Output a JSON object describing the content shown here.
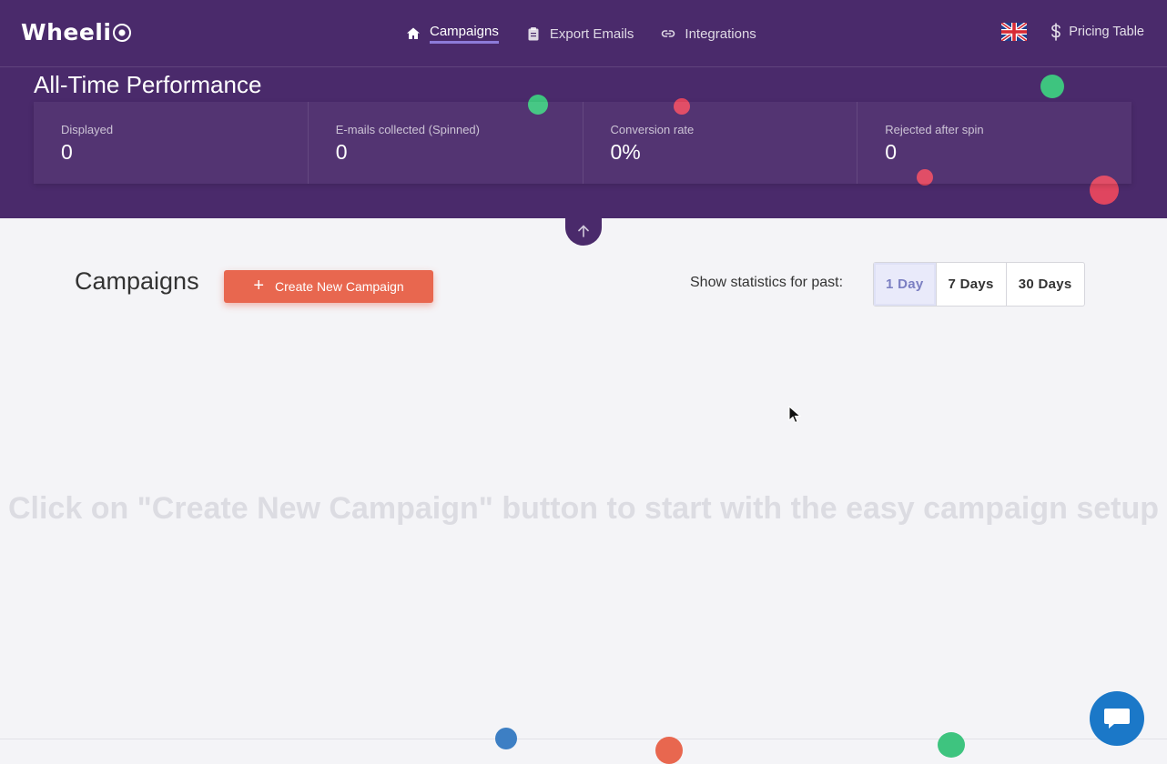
{
  "logo": {
    "text": "Wheeli"
  },
  "nav": {
    "items": [
      {
        "label": "Campaigns",
        "icon": "home-icon",
        "active": true
      },
      {
        "label": "Export Emails",
        "icon": "clipboard-icon",
        "active": false
      },
      {
        "label": "Integrations",
        "icon": "link-icon",
        "active": false
      }
    ],
    "language_icon": "uk-flag-icon",
    "pricing_label": "Pricing Table"
  },
  "performance": {
    "title": "All-Time Performance",
    "stats": [
      {
        "label": "Displayed",
        "value": "0"
      },
      {
        "label": "E-mails collected (Spinned)",
        "value": "0"
      },
      {
        "label": "Conversion rate",
        "value": "0%"
      },
      {
        "label": "Rejected after spin",
        "value": "0"
      }
    ]
  },
  "campaigns": {
    "title": "Campaigns",
    "create_button_label": "Create New Campaign",
    "stats_period_label": "Show statistics for past:",
    "periods": [
      {
        "label": "1 Day",
        "active": true
      },
      {
        "label": "7 Days",
        "active": false
      },
      {
        "label": "30 Days",
        "active": false
      }
    ],
    "empty_message": "Click on \"Create New Campaign\" button to start with the easy campaign setup"
  },
  "colors": {
    "header_bg": "#4a2a6b",
    "accent_orange": "#e8674f",
    "active_nav_underline": "#8d7bd9",
    "chat_button": "#1b78c8"
  }
}
